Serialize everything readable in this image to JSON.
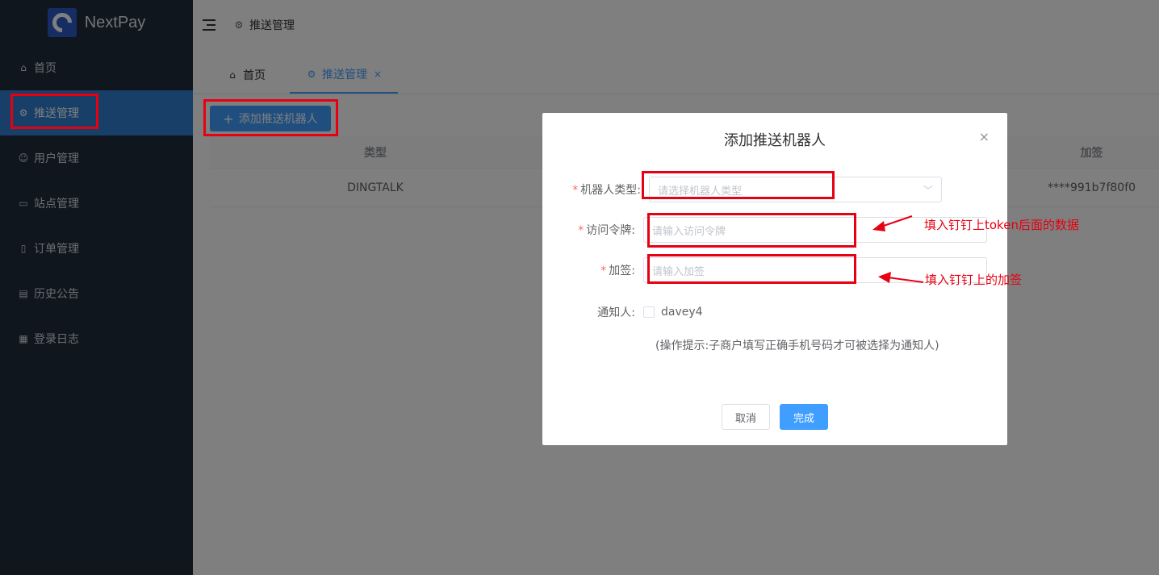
{
  "app": {
    "name": "NextPay"
  },
  "sidebar": {
    "items": [
      {
        "label": "首页",
        "icon": "home-icon"
      },
      {
        "label": "推送管理",
        "icon": "gear-icon",
        "active": true
      },
      {
        "label": "用户管理",
        "icon": "user-icon"
      },
      {
        "label": "站点管理",
        "icon": "site-icon"
      },
      {
        "label": "订单管理",
        "icon": "order-icon"
      },
      {
        "label": "历史公告",
        "icon": "notice-icon"
      },
      {
        "label": "登录日志",
        "icon": "log-icon"
      }
    ]
  },
  "header": {
    "breadcrumb": "推送管理"
  },
  "tabs": [
    {
      "label": "首页"
    },
    {
      "label": "推送管理",
      "close": "×",
      "active": true
    }
  ],
  "toolbar": {
    "add_label": "添加推送机器人"
  },
  "table": {
    "columns": [
      "类型",
      "加签"
    ],
    "rows": [
      {
        "type": "DINGTALK",
        "sign": "****991b7f80f0"
      }
    ]
  },
  "dialog": {
    "title": "添加推送机器人",
    "close": "×",
    "fields": {
      "robot_type": {
        "label": "机器人类型:",
        "placeholder": "请选择机器人类型"
      },
      "token": {
        "label": "访问令牌:",
        "placeholder": "请输入访问令牌"
      },
      "sign": {
        "label": "加签:",
        "placeholder": "请输入加签"
      },
      "notify": {
        "label": "通知人:",
        "option": "davey4"
      }
    },
    "hint": "(操作提示:子商户填写正确手机号码才可被选择为通知人)",
    "cancel_label": "取消",
    "ok_label": "完成"
  },
  "annotations": {
    "token_note": "填入钉钉上token后面的数据",
    "sign_note": "填入钉钉上的加签",
    "color": "#e60012"
  },
  "colors": {
    "sidebar": "#1f2d3d",
    "active": "#2f7fd1",
    "primary": "#409eff"
  }
}
